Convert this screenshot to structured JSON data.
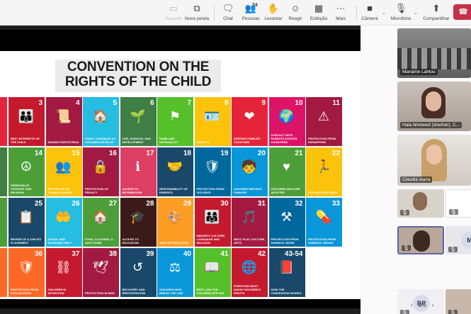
{
  "toolbar": {
    "assunto": "Assunto",
    "nova_janela": "Nova janela",
    "chat": "Chat",
    "pessoas": "Pessoas",
    "pessoas_count": "34",
    "levantar": "Levantar",
    "reagir": "Reagir",
    "exibicao": "Exibição",
    "mais": "Mais",
    "camera": "Câmera",
    "microfone": "Microfone",
    "compartilhar": "Compartilhar"
  },
  "slide": {
    "title_line1": "CONVENTION ON THE",
    "title_line2": "RIGHTS OF THE CHILD",
    "cells": [
      {
        "num": "2",
        "cap": "",
        "color": "#e5243b"
      },
      {
        "num": "3",
        "cap": "Best interests of the child",
        "color": "#c5192d"
      },
      {
        "num": "4",
        "cap": "Making rights real",
        "color": "#a21942"
      },
      {
        "num": "5",
        "cap": "Family guidance as children develop",
        "color": "#26bde2"
      },
      {
        "num": "6",
        "cap": "Life, survival and development",
        "color": "#3f7e44"
      },
      {
        "num": "7",
        "cap": "Name and nationality",
        "color": "#56c02b"
      },
      {
        "num": "8",
        "cap": "Identity",
        "color": "#fcc30b"
      },
      {
        "num": "9",
        "cap": "Keeping families together",
        "color": "#e5243b"
      },
      {
        "num": "10",
        "cap": "Contact with parents across countries",
        "color": "#dd1367"
      },
      {
        "num": "11",
        "cap": "Protection from kidnapping",
        "color": "#a21942"
      },
      {
        "num": "13",
        "cap": "",
        "color": "#3f7e44"
      },
      {
        "num": "14",
        "cap": "Freedom of thought and religion",
        "color": "#4c9f38"
      },
      {
        "num": "15",
        "cap": "Setting up or joining groups",
        "color": "#fcc30b"
      },
      {
        "num": "16",
        "cap": "Protection of privacy",
        "color": "#a21942"
      },
      {
        "num": "17",
        "cap": "Access to information",
        "color": "#dd3e63"
      },
      {
        "num": "18",
        "cap": "Responsibility of parents",
        "color": "#19486a"
      },
      {
        "num": "19",
        "cap": "Protection from violence",
        "color": "#00689d"
      },
      {
        "num": "20",
        "cap": "Children without families",
        "color": "#0a97d9"
      },
      {
        "num": "21",
        "cap": "Children who are adopted",
        "color": "#4c9f38"
      },
      {
        "num": "22",
        "cap": "Refugee children",
        "color": "#fcc30b"
      },
      {
        "num": "24",
        "cap": "",
        "color": "#4c9f38"
      },
      {
        "num": "25",
        "cap": "Review of a child's placement",
        "color": "#19486a"
      },
      {
        "num": "26",
        "cap": "Social and economic help",
        "color": "#26bde2"
      },
      {
        "num": "27",
        "cap": "Food, clothing, a safe home",
        "color": "#4c9f38"
      },
      {
        "num": "28",
        "cap": "Access to education",
        "color": "#3d1a1a"
      },
      {
        "num": "29",
        "cap": "Aims of education",
        "color": "#fd9d24"
      },
      {
        "num": "30",
        "cap": "Minority culture, language and religion",
        "color": "#c5192d"
      },
      {
        "num": "31",
        "cap": "Rest, play, culture, arts",
        "color": "#a21942"
      },
      {
        "num": "32",
        "cap": "Protection from harmful work",
        "color": "#00689d"
      },
      {
        "num": "33",
        "cap": "Protection from harmful drugs",
        "color": "#0a97d9"
      },
      {
        "num": "35",
        "cap": "",
        "color": "#fd6925"
      },
      {
        "num": "36",
        "cap": "Protection from exploitation",
        "color": "#fd6925"
      },
      {
        "num": "37",
        "cap": "Children in detention",
        "color": "#c5192d"
      },
      {
        "num": "38",
        "cap": "Protection in war",
        "color": "#a21942"
      },
      {
        "num": "39",
        "cap": "Recovery and reintegration",
        "color": "#19486a"
      },
      {
        "num": "40",
        "cap": "Children who break the law",
        "color": "#0a97d9"
      },
      {
        "num": "41",
        "cap": "Best law for children applies",
        "color": "#56c02b"
      },
      {
        "num": "42",
        "cap": "Everyone must know children's rights",
        "color": "#c5192d"
      },
      {
        "num": "43-54",
        "cap": "How the convention works",
        "color": "#19486a"
      }
    ]
  },
  "participants": [
    {
      "name": "Mariame Lahlou"
    },
    {
      "name": "Hala Mreiwed (she/her), C..."
    },
    {
      "name": "Claudia viana"
    }
  ],
  "small_tiles": [
    "",
    "",
    "",
    "M",
    "BP",
    ""
  ],
  "pager": {
    "text": "1/6"
  }
}
